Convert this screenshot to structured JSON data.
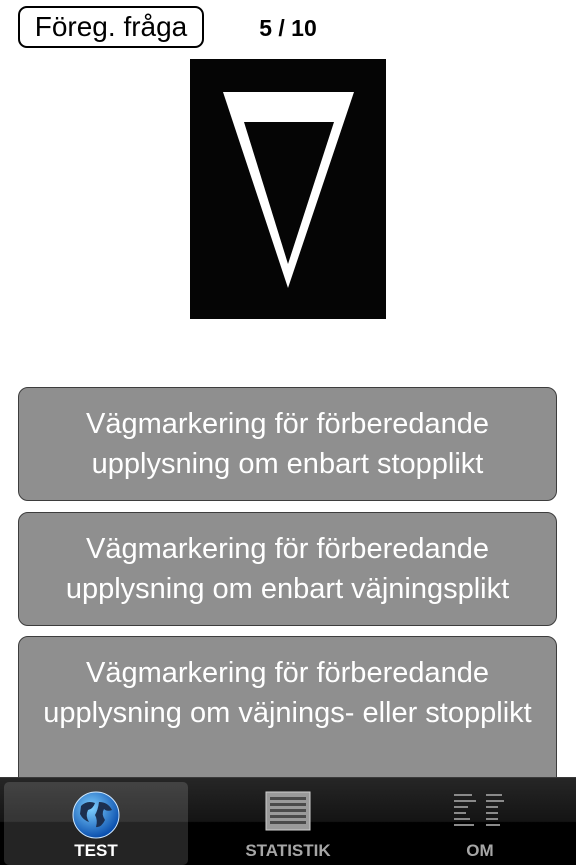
{
  "header": {
    "prev_label": "Föreg. fråga",
    "counter": "5 / 10"
  },
  "question": {
    "sign_icon": "yield-road-marking-inverted-triangle"
  },
  "answers": [
    "Vägmarkering för förberedande upplysning om enbart stopplikt",
    "Vägmarkering för förberedande upplysning om enbart väjningsplikt",
    "Vägmarkering för förberedande upplysning om väjnings- eller stopplikt"
  ],
  "tabs": [
    {
      "label": "TEST",
      "icon": "globe-icon",
      "active": true
    },
    {
      "label": "STATISTIK",
      "icon": "list-icon",
      "active": false
    },
    {
      "label": "OM",
      "icon": "info-table-icon",
      "active": false
    }
  ],
  "colors": {
    "answer_bg": "#8f8f8f",
    "tabbar_bg": "#141414"
  }
}
